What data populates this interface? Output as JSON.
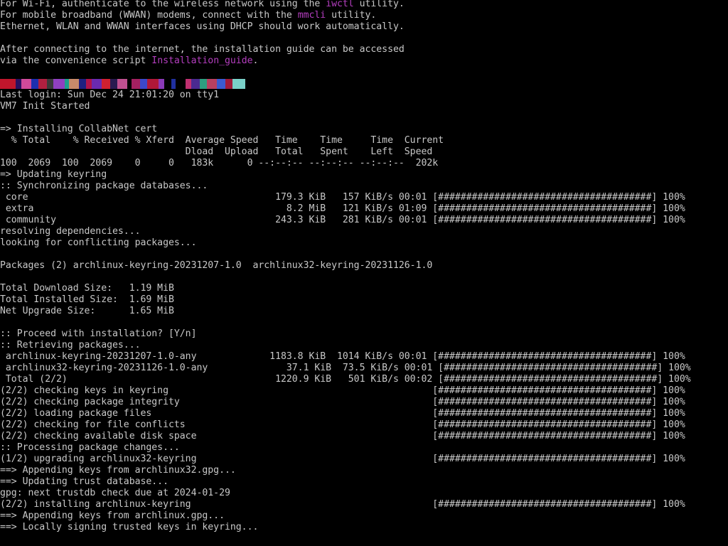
{
  "colors": {
    "background": "#000000",
    "foreground": "#c8c8c8",
    "highlight": "#b43ebf"
  },
  "terminal": {
    "intro": {
      "wifi_prefix": "For Wi-Fi, authenticate to the wireless network using the ",
      "wifi_cmd": "iwctl",
      "wifi_suffix": " utility.",
      "wwan_prefix": "For mobile broadband (WWAN) modems, connect with the ",
      "wwan_cmd": "mmcli",
      "wwan_suffix": " utility.",
      "dhcp": "Ethernet, WLAN and WWAN interfaces using DHCP should work automatically.",
      "guide_1": "After connecting to the internet, the installation guide can be accessed",
      "guide_2_prefix": "via the convenience script ",
      "guide_2_cmd": "Installation_guide",
      "guide_2_suffix": "."
    },
    "lines": [
      "Last login: Sun Dec 24 21:01:20 on tty1",
      "VM7 Init Started",
      "",
      "=> Installing CollabNet cert",
      "  % Total    % Received % Xferd  Average Speed   Time    Time     Time  Current",
      "                                 Dload  Upload   Total   Spent    Left  Speed",
      "100  2069  100  2069    0     0   183k      0 --:--:-- --:--:-- --:--:--  202k",
      "=> Updating keyring",
      ":: Synchronizing package databases...",
      " core                                            179.3 KiB   157 KiB/s 00:01 [######################################] 100%",
      " extra                                             8.2 MiB   121 KiB/s 01:09 [######################################] 100%",
      " community                                       243.3 KiB   281 KiB/s 00:01 [######################################] 100%",
      "resolving dependencies...",
      "looking for conflicting packages...",
      "",
      "Packages (2) archlinux-keyring-20231207-1.0  archlinux32-keyring-20231126-1.0",
      "",
      "Total Download Size:   1.19 MiB",
      "Total Installed Size:  1.69 MiB",
      "Net Upgrade Size:      1.65 MiB",
      "",
      ":: Proceed with installation? [Y/n]",
      ":: Retrieving packages...",
      " archlinux-keyring-20231207-1.0-any             1183.8 KiB  1014 KiB/s 00:01 [######################################] 100%",
      " archlinux32-keyring-20231126-1.0-any              37.1 KiB  73.5 KiB/s 00:01 [######################################] 100%",
      " Total (2/2)                                     1220.9 KiB   501 KiB/s 00:02 [######################################] 100%",
      "(2/2) checking keys in keyring                                               [######################################] 100%",
      "(2/2) checking package integrity                                             [######################################] 100%",
      "(2/2) loading package files                                                  [######################################] 100%",
      "(2/2) checking for file conflicts                                            [######################################] 100%",
      "(2/2) checking available disk space                                          [######################################] 100%",
      ":: Processing package changes...",
      "(1/2) upgrading archlinux32-keyring                                          [######################################] 100%",
      "==> Appending keys from archlinux32.gpg...",
      "==> Updating trust database...",
      "gpg: next trustdb check due at 2024-01-29",
      "(2/2) installing archlinux-keyring                                           [######################################] 100%",
      "==> Appending keys from archlinux.gpg...",
      "==> Locally signing trusted keys in keyring..."
    ]
  }
}
